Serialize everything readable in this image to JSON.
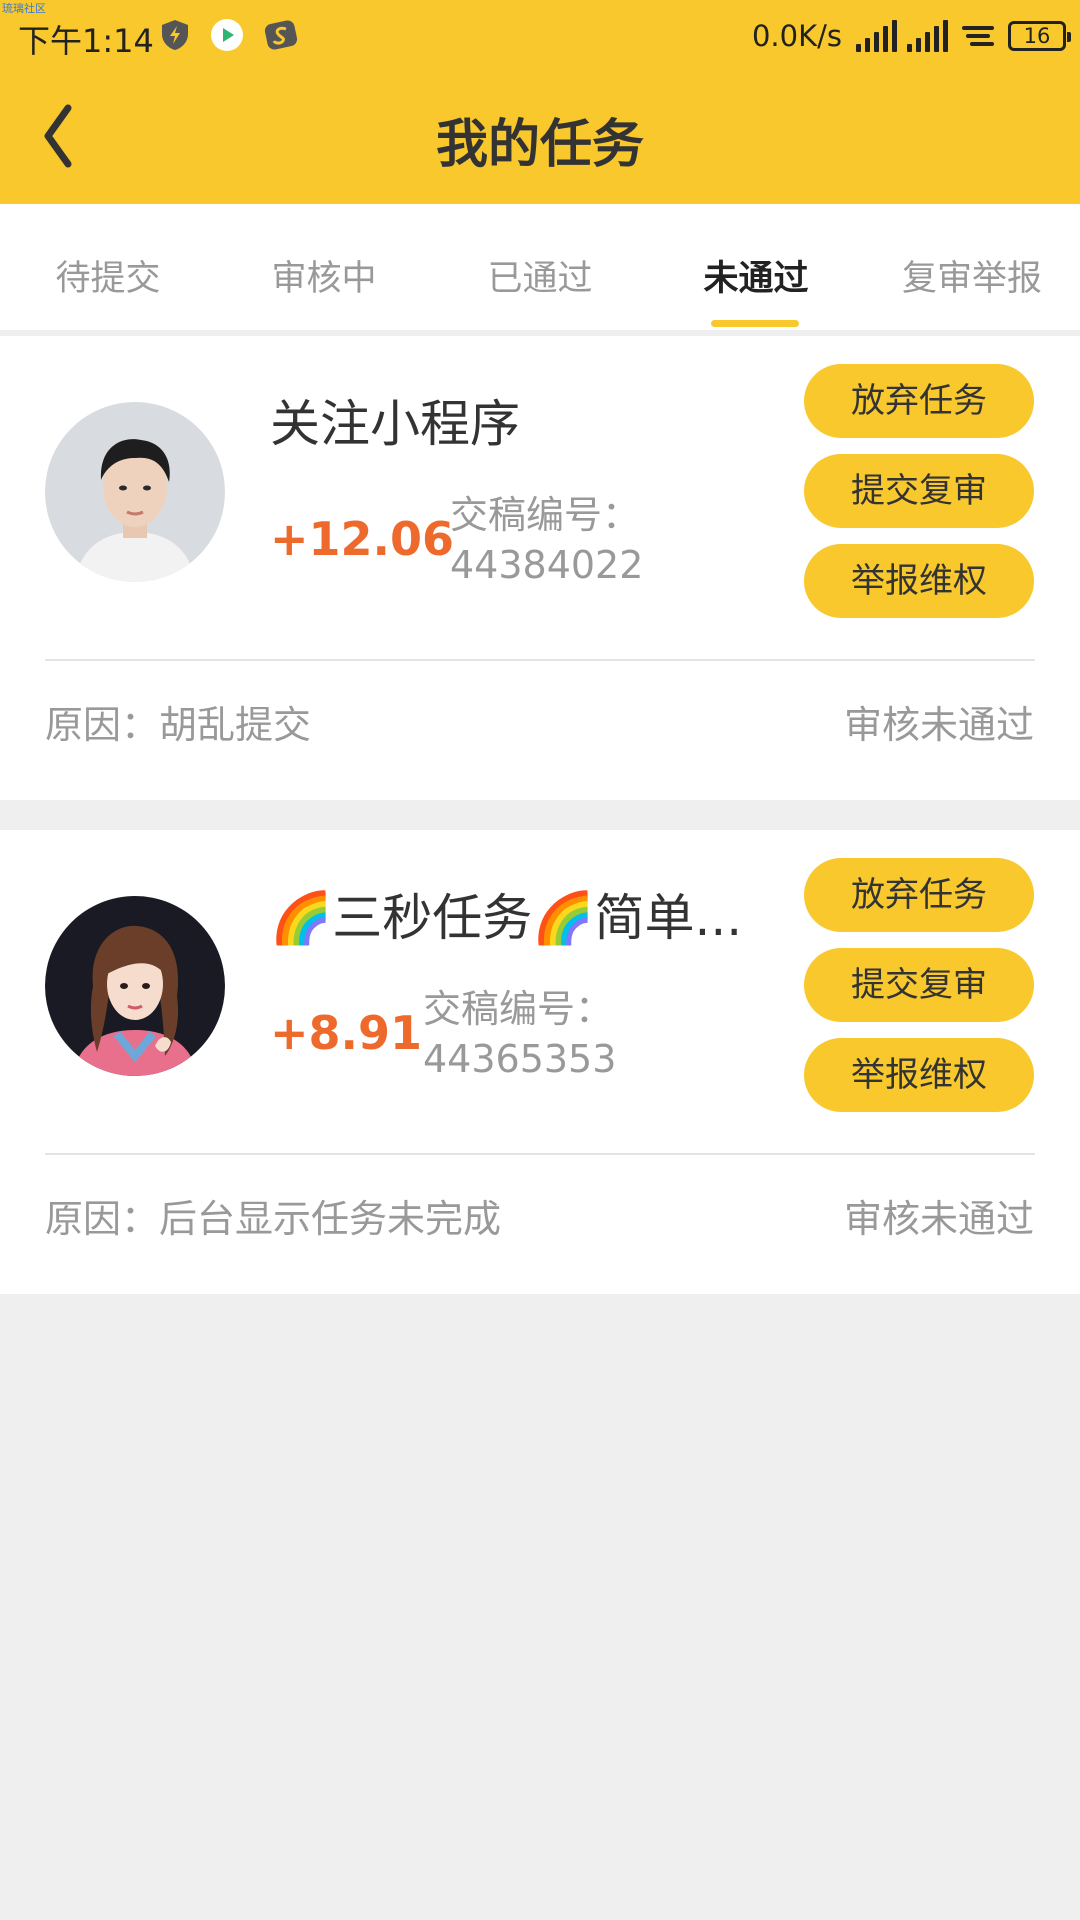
{
  "status_bar": {
    "watermark": "琉璃社区",
    "time": "下午1:14",
    "network_speed": "0.0K/s",
    "battery": "16"
  },
  "header": {
    "title": "我的任务"
  },
  "tabs": [
    {
      "label": "待提交",
      "active": false
    },
    {
      "label": "审核中",
      "active": false
    },
    {
      "label": "已通过",
      "active": false
    },
    {
      "label": "未通过",
      "active": true
    },
    {
      "label": "复审举报",
      "active": false
    }
  ],
  "tasks": [
    {
      "title": "关注小程序",
      "reward": "+12.06",
      "submission_label": "交稿编号：",
      "submission_id": "44384022",
      "buttons": [
        "放弃任务",
        "提交复审",
        "举报维权"
      ],
      "reason": "原因：胡乱提交",
      "status": "审核未通过"
    },
    {
      "title": "🌈三秒任务🌈简单...",
      "reward": "+8.91",
      "submission_label": "交稿编号：",
      "submission_id": "44365353",
      "buttons": [
        "放弃任务",
        "提交复审",
        "举报维权"
      ],
      "reason": "原因：后台显示任务未完成",
      "status": "审核未通过"
    }
  ],
  "colors": {
    "accent": "#f8c82c",
    "reward": "#ee6a2c",
    "muted_text": "#999999",
    "background": "#efefef"
  }
}
